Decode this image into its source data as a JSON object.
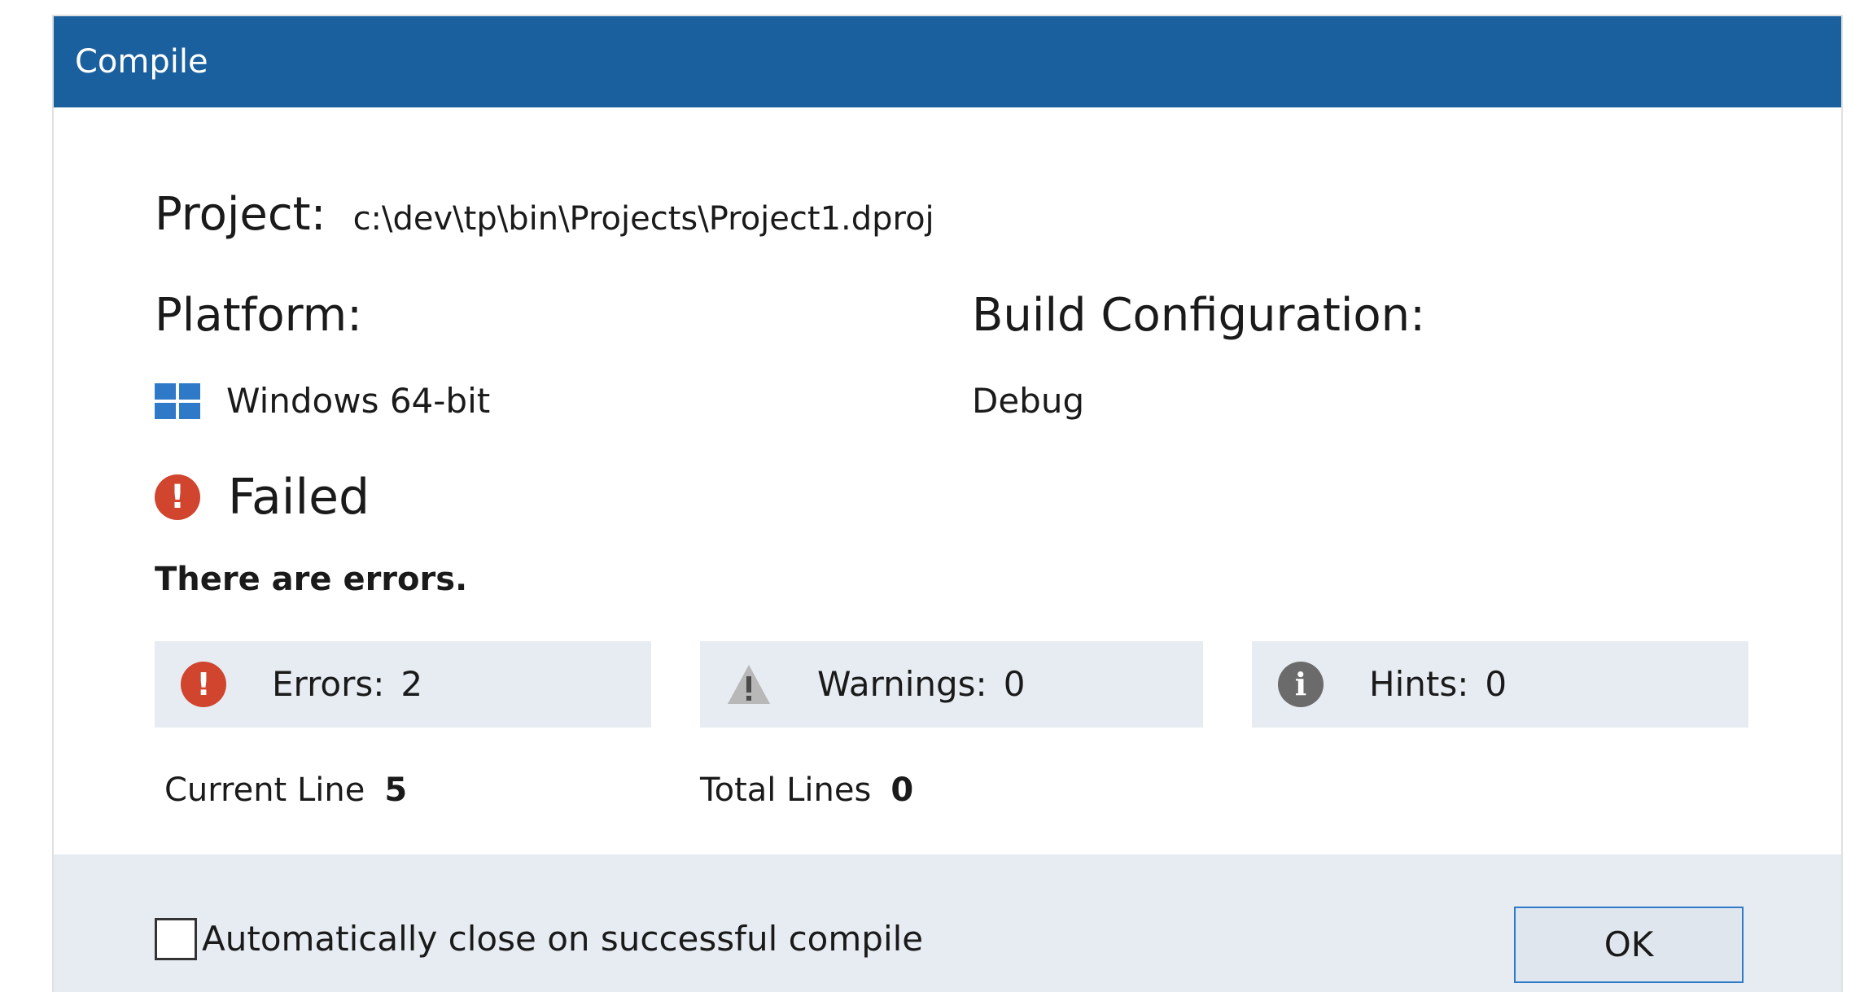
{
  "window": {
    "title": "Compile"
  },
  "project": {
    "label": "Project:",
    "path": "c:\\dev\\tp\\bin\\Projects\\Project1.dproj"
  },
  "platform": {
    "label": "Platform:",
    "value": "Windows 64-bit",
    "icon": "windows-icon"
  },
  "build_configuration": {
    "label": "Build Configuration:",
    "value": "Debug"
  },
  "status": {
    "icon": "error-icon",
    "text": "Failed",
    "message": "There are errors."
  },
  "stats": {
    "errors": {
      "label": "Errors:",
      "value": "2",
      "icon": "error-icon"
    },
    "warnings": {
      "label": "Warnings:",
      "value": "0",
      "icon": "warning-icon"
    },
    "hints": {
      "label": "Hints:",
      "value": "0",
      "icon": "info-icon"
    }
  },
  "lines": {
    "current_label": "Current Line",
    "current_value": "5",
    "total_label": "Total Lines",
    "total_value": "0"
  },
  "footer": {
    "auto_close_label": "Automatically close on successful compile",
    "auto_close_checked": false,
    "ok_label": "OK"
  },
  "colors": {
    "titlebar": "#1a5f9e",
    "error": "#d1452f",
    "stat_background": "#e6ecf2",
    "accent": "#2f7ac8"
  }
}
